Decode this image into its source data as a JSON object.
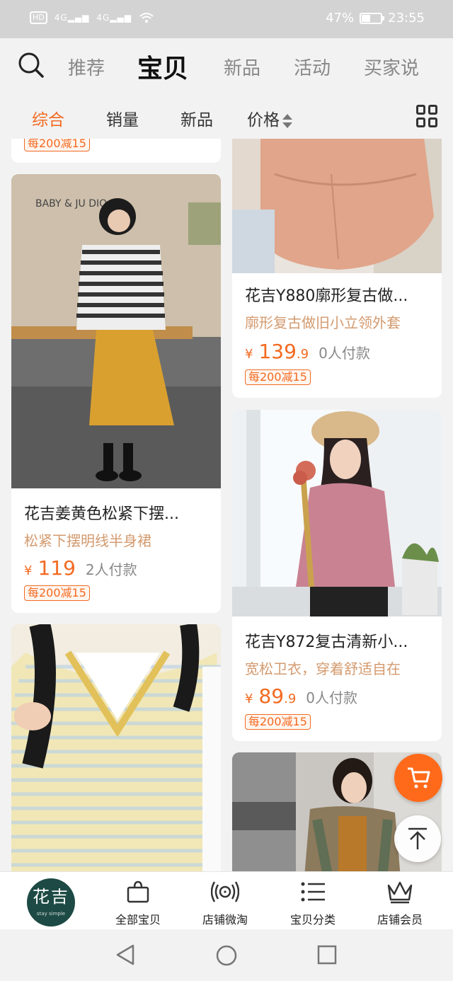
{
  "status_bar": {
    "hd": "HD",
    "sig1": "4G",
    "sig2": "4G",
    "battery": "47%",
    "battery_level": 0.47,
    "time": "23:55"
  },
  "top_nav": {
    "tabs": [
      "推荐",
      "宝贝",
      "新品",
      "活动",
      "买家说"
    ],
    "active_index": 1
  },
  "filter_bar": {
    "items": [
      "综合",
      "销量",
      "新品",
      "价格"
    ],
    "active_index": 0
  },
  "products": [
    {
      "coupon": "每200减15"
    },
    {
      "title": "花吉Y880廓形复古做...",
      "subtitle": "廓形复古做旧小立领外套",
      "yen": "¥",
      "price_int": "139",
      "price_dec": ".9",
      "sold": "0人付款",
      "coupon": "每200减15"
    },
    {
      "title": "花吉姜黄色松紧下摆...",
      "subtitle": "松紧下摆明线半身裙",
      "yen": "¥",
      "price_int": "119",
      "price_dec": "",
      "sold": "2人付款",
      "coupon": "每200减15",
      "image_text": "BABY & JU      DIO"
    },
    {
      "title": "花吉Y872复古清新小...",
      "subtitle": "宽松卫衣，穿着舒适自在",
      "yen": "¥",
      "price_int": "89",
      "price_dec": ".9",
      "sold": "0人付款",
      "coupon": "每200减15"
    }
  ],
  "bottom_bar": {
    "logo_text": "花吉",
    "logo_sub": "stay simple",
    "items": [
      "全部宝贝",
      "店铺微淘",
      "宝贝分类",
      "店铺会员"
    ]
  },
  "colors": {
    "accent": "#f36a21",
    "subtitle": "#d39a6e",
    "logo_bg": "#1d4a44"
  },
  "icons": [
    "search-icon",
    "sort-icon",
    "grid-view-icon",
    "cart-icon",
    "back-to-top-icon",
    "bag-icon",
    "broadcast-icon",
    "list-icon",
    "crown-icon",
    "back-icon",
    "home-icon",
    "recent-icon"
  ]
}
